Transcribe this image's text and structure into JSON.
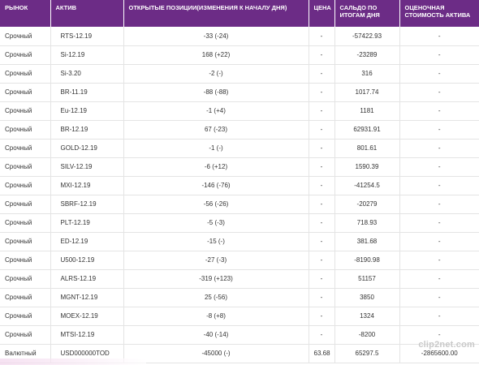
{
  "table": {
    "headers": {
      "market": "РЫНОК",
      "asset": "АКТИВ",
      "positions": "ОТКРЫТЫЕ ПОЗИЦИИ(ИЗМЕНЕНИЯ К НАЧАЛУ ДНЯ)",
      "price": "ЦЕНА",
      "balance": "САЛЬДО ПО ИТОГАМ ДНЯ",
      "value": "ОЦЕНОЧНАЯ СТОИМОСТЬ АКТИВА"
    },
    "rows": [
      {
        "market": "Срочный",
        "asset": "RTS-12.19",
        "positions": "-33 (-24)",
        "price": "-",
        "balance": "-57422.93",
        "value": "-"
      },
      {
        "market": "Срочный",
        "asset": "Si-12.19",
        "positions": "168 (+22)",
        "price": "-",
        "balance": "-23289",
        "value": "-"
      },
      {
        "market": "Срочный",
        "asset": "Si-3.20",
        "positions": "-2 (-)",
        "price": "-",
        "balance": "316",
        "value": "-"
      },
      {
        "market": "Срочный",
        "asset": "BR-11.19",
        "positions": "-88 (-88)",
        "price": "-",
        "balance": "1017.74",
        "value": "-"
      },
      {
        "market": "Срочный",
        "asset": "Eu-12.19",
        "positions": "-1 (+4)",
        "price": "-",
        "balance": "1181",
        "value": "-"
      },
      {
        "market": "Срочный",
        "asset": "BR-12.19",
        "positions": "67 (-23)",
        "price": "-",
        "balance": "62931.91",
        "value": "-"
      },
      {
        "market": "Срочный",
        "asset": "GOLD-12.19",
        "positions": "-1 (-)",
        "price": "-",
        "balance": "801.61",
        "value": "-"
      },
      {
        "market": "Срочный",
        "asset": "SILV-12.19",
        "positions": "-6 (+12)",
        "price": "-",
        "balance": "1590.39",
        "value": "-"
      },
      {
        "market": "Срочный",
        "asset": "MXI-12.19",
        "positions": "-146 (-76)",
        "price": "-",
        "balance": "-41254.5",
        "value": "-"
      },
      {
        "market": "Срочный",
        "asset": "SBRF-12.19",
        "positions": "-56 (-26)",
        "price": "-",
        "balance": "-20279",
        "value": "-"
      },
      {
        "market": "Срочный",
        "asset": "PLT-12.19",
        "positions": "-5 (-3)",
        "price": "-",
        "balance": "718.93",
        "value": "-"
      },
      {
        "market": "Срочный",
        "asset": "ED-12.19",
        "positions": "-15 (-)",
        "price": "-",
        "balance": "381.68",
        "value": "-"
      },
      {
        "market": "Срочный",
        "asset": "U500-12.19",
        "positions": "-27 (-3)",
        "price": "-",
        "balance": "-8190.98",
        "value": "-"
      },
      {
        "market": "Срочный",
        "asset": "ALRS-12.19",
        "positions": "-319 (+123)",
        "price": "-",
        "balance": "51157",
        "value": "-"
      },
      {
        "market": "Срочный",
        "asset": "MGNT-12.19",
        "positions": "25 (-56)",
        "price": "-",
        "balance": "3850",
        "value": "-"
      },
      {
        "market": "Срочный",
        "asset": "MOEX-12.19",
        "positions": "-8 (+8)",
        "price": "-",
        "balance": "1324",
        "value": "-"
      },
      {
        "market": "Срочный",
        "asset": "MTSI-12.19",
        "positions": "-40 (-14)",
        "price": "-",
        "balance": "-8200",
        "value": "-"
      },
      {
        "market": "Валютный",
        "asset": "USD000000TOD",
        "positions": "-45000 (-)",
        "price": "63.68",
        "balance": "65297.5",
        "value": "-2865600.00"
      }
    ]
  },
  "watermark": "clip2net.com",
  "colors": {
    "header_bg": "#6c2c86",
    "header_text": "#ffffff",
    "row_border": "#e4e4e4"
  }
}
